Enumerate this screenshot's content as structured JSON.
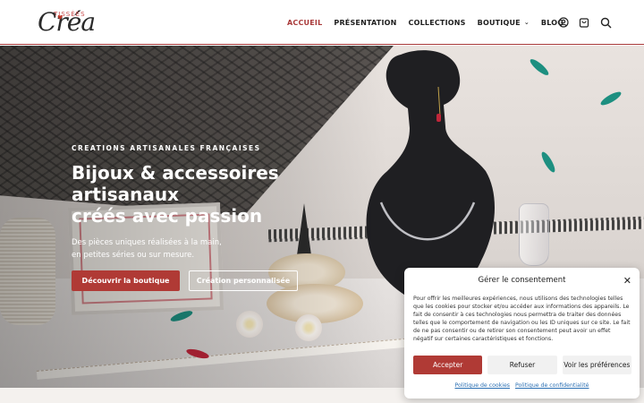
{
  "brand": {
    "logo_script": "Créa",
    "logo_small": "TISSÉES"
  },
  "nav": {
    "items": [
      {
        "label": "ACCUEIL"
      },
      {
        "label": "PRÉSENTATION"
      },
      {
        "label": "COLLECTIONS"
      },
      {
        "label": "BOUTIQUE"
      },
      {
        "label": "BLOG"
      }
    ],
    "active": "ACCUEIL",
    "icons": [
      "user-icon",
      "cart-icon",
      "search-icon"
    ]
  },
  "hero": {
    "eyebrow": "CREATIONS ARTISANALES FRANÇAISES",
    "title_lines": [
      "Bijoux & accessoires",
      "artisanaux",
      "créés avec passion"
    ],
    "subtitle_lines": [
      "Des pièces uniques réalisées à la main,",
      "en petites séries ou sur mesure."
    ],
    "primary_button": "Découvrir la boutique",
    "secondary_button": "Création personnalisée"
  },
  "cookie": {
    "title": "Gérer le consentement",
    "text": "Pour offrir les meilleures expériences, nous utilisons des technologies telles que les cookies pour stocker et/ou accéder aux informations des appareils. Le fait de consentir à ces technologies nous permettra de traiter des données telles que le comportement de navigation ou les ID uniques sur ce site. Le fait de ne pas consentir ou de retirer son consentement peut avoir un effet négatif sur certaines caractéristiques et fonctions.",
    "accept": "Accepter",
    "refuse": "Refuser",
    "prefs": "Voir les préférences",
    "link_cookies": "Politique de cookies",
    "link_privacy": "Politique de confidentialité"
  },
  "colors": {
    "accent": "#b03a35",
    "link": "#2a6fb3"
  }
}
